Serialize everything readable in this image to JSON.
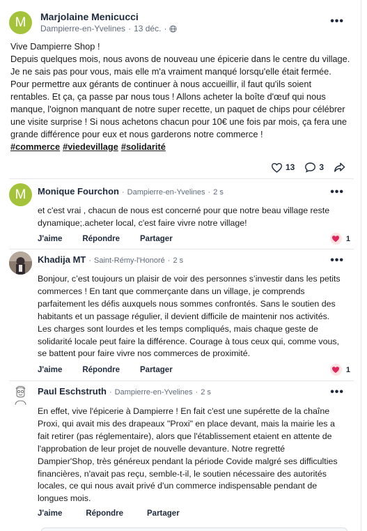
{
  "post": {
    "author": "Marjolaine Menicucci",
    "avatar_letter": "M",
    "location": "Dampierre-en-Yvelines",
    "date": "13 déc.",
    "separator": "·",
    "body_lines": [
      "Vive Dampierre Shop !",
      "Depuis quelques mois, nous avons de nouveau une épicerie dans le centre du village.",
      "Je ne sais pas pour vous,  mais elle m'a vraiment manqué lorsqu'elle était fermée.",
      "Pour permettre aux gérants de continuer à nous accueillir,  il faut qu'ils soient",
      "rentables. Et ça,  ça passe par nous tous ! Allons acheter la boîte d'œuf qui nous",
      "manque, l'oignon manquant de notre super recette, un paquet de chips pour célébrer",
      "une visite surprise ! Si nous achetons chacun pour 10€ une fois par mois, ça fera une",
      "grande différence pour eux et nous garderons notre commerce !"
    ],
    "hashtags": [
      "#commerce",
      "#viedevillage",
      "#solidarité"
    ],
    "likes": "13",
    "comments": "3"
  },
  "actions": {
    "like": "J'aime",
    "reply": "Répondre",
    "share": "Partager"
  },
  "comments": [
    {
      "author": "Monique Fourchon",
      "avatar_letter": "M",
      "location": "Dampierre-en-Yvelines",
      "time": "2 s",
      "lines": [
        "et c'est vrai , chacun de nous est concerné pour que notre beau village reste",
        "dynamique;.acheter local, c'est faire vivre notre village!"
      ],
      "likes": "1"
    },
    {
      "author": "Khadija MT",
      "location": "Saint-Rémy-l'Honoré",
      "time": "2 s",
      "lines": [
        "Bonjour, c’est toujours un plaisir de voir des personnes s’investir dans les petits",
        "commerces ! En tant que commerçante dans un village, je comprends",
        "parfaitement les défis auxquels nous sommes confrontés. Sans le soutien des",
        "habitants et un passage régulier, il devient difficile de maintenir nos activités.",
        "Les charges sont lourdes et les temps compliqués, mais chaque geste de",
        "solidarité locale peut faire la différence. Courage à tous ceux qui, comme vous,",
        "se battent pour faire vivre nos commerces de proximité."
      ],
      "likes": "1"
    },
    {
      "author": "Paul Eschstruth",
      "location": "Dampierre-en-Yvelines",
      "time": "2 s",
      "lines": [
        "En effet, vive l'épicerie à Dampierre ! En fait c'est une supérette de la chaîne",
        "Proxi, qui avait mis des drapeaux \"Proxi\" en place devant, mais la mairie les a",
        "fait retirer (pas réglementaire), alors que l'établissement etaient en attente de",
        "l'approbation de leur projet de nouvelle devanture. Notre regretté",
        "Dampier'Shop, très généreux pendant la période Covide malgré ses difficulties",
        "financières, n'avait pas reçu, semble-t-il, le soutien nécessaire des autorités",
        "locales, ce qui nous avait privé d'un commerce indispensable pendant de",
        "longues mois."
      ]
    }
  ],
  "colors": {
    "avatar_green": "#a4c33a",
    "heart_red": "#e0245e"
  }
}
